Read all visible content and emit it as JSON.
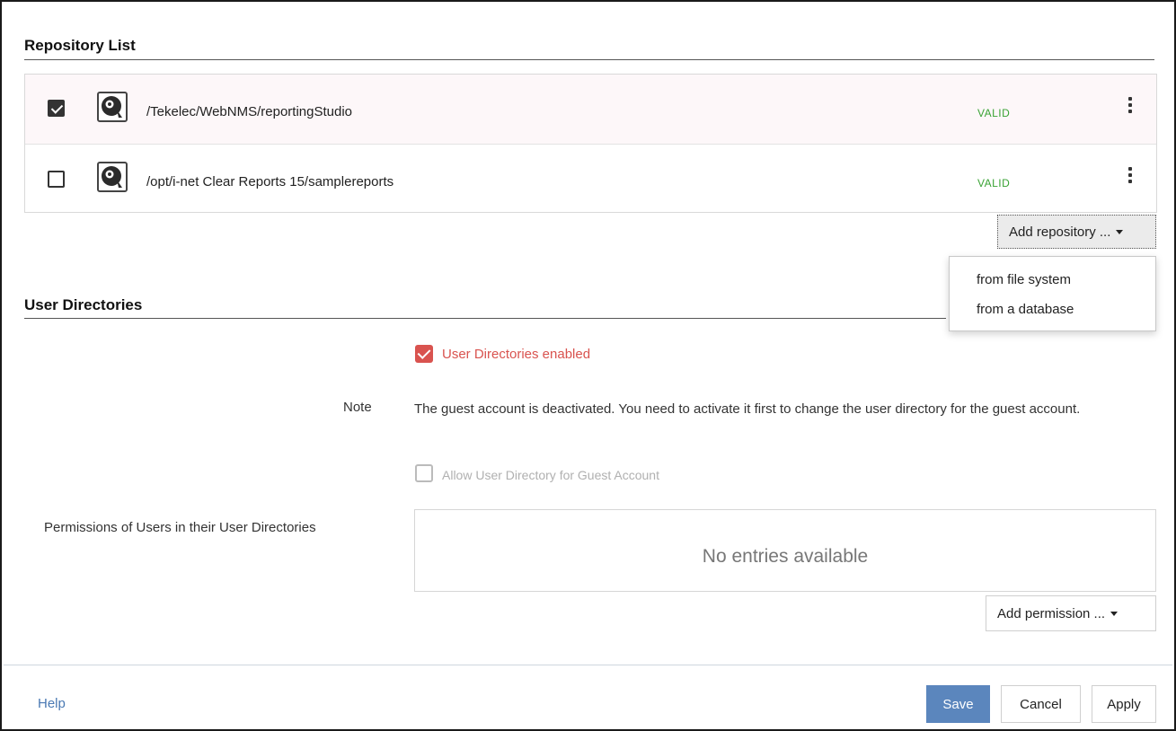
{
  "repository_list": {
    "title": "Repository List",
    "rows": [
      {
        "path": "/Tekelec/WebNMS/reportingStudio",
        "status": "VALID",
        "checked": true
      },
      {
        "path": "/opt/i-net Clear Reports 15/samplereports",
        "status": "VALID",
        "checked": false
      }
    ],
    "add_button_label": "Add repository ...",
    "menu_items": [
      "from file system",
      "from a database"
    ]
  },
  "user_directories": {
    "title": "User Directories",
    "enabled_label": "User Directories enabled",
    "note_label": "Note",
    "note_text": "The guest account is deactivated. You need to activate it first to change the user directory for the guest account.",
    "guest_label": "Allow User Directory for Guest Account",
    "permissions_label": "Permissions of Users in their User Directories",
    "permissions_empty": "No entries available",
    "add_permission_label": "Add permission ..."
  },
  "footer": {
    "help_label": "Help",
    "save_label": "Save",
    "cancel_label": "Cancel",
    "apply_label": "Apply"
  },
  "colors": {
    "status_valid": "#3aa335",
    "checkbox_red": "#d9534f",
    "primary_button": "#5b86bd",
    "link": "#4a79b3"
  },
  "icons": [
    "checkbox-checked-icon",
    "checkbox-empty-icon",
    "repository-disk-icon",
    "more-vertical-icon",
    "caret-down-icon"
  ]
}
